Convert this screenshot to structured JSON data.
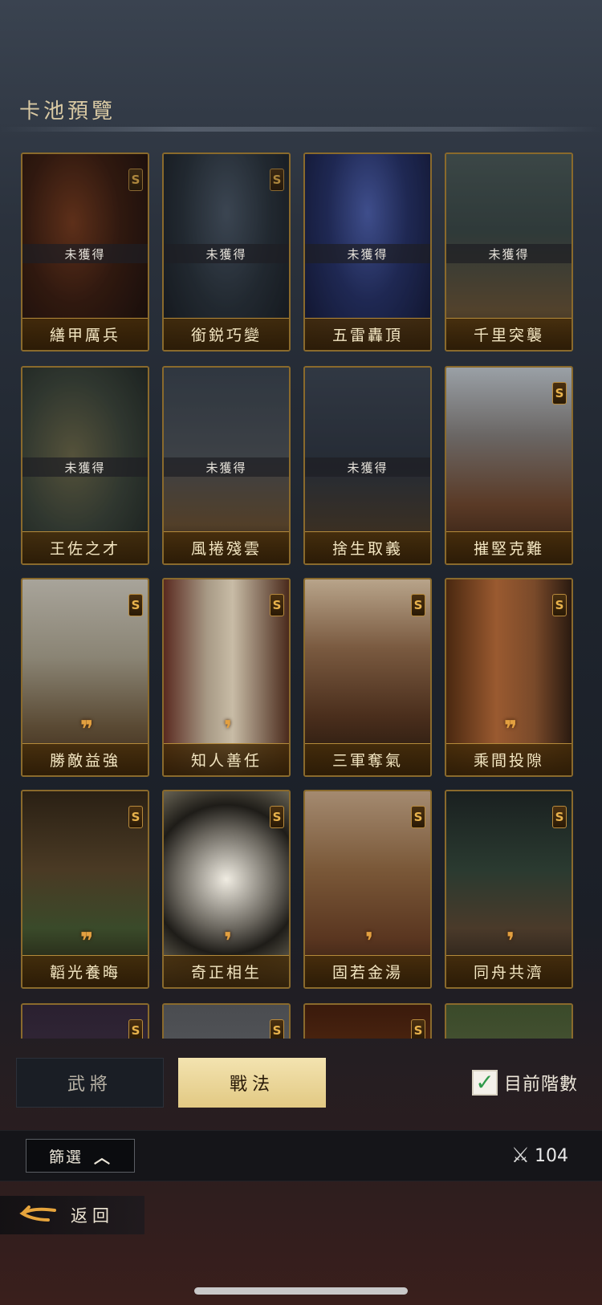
{
  "page_title": "卡池預覽",
  "unobtained_label": "未獲得",
  "cards": [
    {
      "name": "繕甲厲兵",
      "grade": "S",
      "obtained": false
    },
    {
      "name": "銜鋭巧變",
      "grade": "S",
      "obtained": false
    },
    {
      "name": "五雷轟頂",
      "grade": "",
      "obtained": false
    },
    {
      "name": "千里突襲",
      "grade": "",
      "obtained": false
    },
    {
      "name": "王佐之才",
      "grade": "",
      "obtained": false
    },
    {
      "name": "風捲殘雲",
      "grade": "",
      "obtained": false
    },
    {
      "name": "捨生取義",
      "grade": "",
      "obtained": false
    },
    {
      "name": "摧堅克難",
      "grade": "S",
      "obtained": true
    },
    {
      "name": "勝敵益強",
      "grade": "S",
      "obtained": true,
      "quotes": 2
    },
    {
      "name": "知人善任",
      "grade": "S",
      "obtained": true,
      "quotes": 1
    },
    {
      "name": "三軍奪氣",
      "grade": "S",
      "obtained": true
    },
    {
      "name": "乘間投隙",
      "grade": "S",
      "obtained": true,
      "quotes": 2
    },
    {
      "name": "韜光養晦",
      "grade": "S",
      "obtained": true,
      "quotes": 2
    },
    {
      "name": "奇正相生",
      "grade": "S",
      "obtained": true,
      "quotes": 1
    },
    {
      "name": "固若金湯",
      "grade": "S",
      "obtained": true,
      "quotes": 1
    },
    {
      "name": "同舟共濟",
      "grade": "S",
      "obtained": true,
      "quotes": 1
    },
    {
      "name": "",
      "grade": "S",
      "obtained": true
    },
    {
      "name": "",
      "grade": "S",
      "obtained": true
    },
    {
      "name": "",
      "grade": "S",
      "obtained": true
    },
    {
      "name": "",
      "grade": "",
      "obtained": true
    }
  ],
  "tabs": {
    "generals": "武將",
    "tactics": "戰法",
    "active": "tactics"
  },
  "current_tier": {
    "label": "目前階數",
    "checked": true
  },
  "filter": {
    "label": "篩選",
    "count": "104"
  },
  "back": {
    "label": "返回"
  },
  "colors": {
    "gold_border": "#8a6a2c",
    "active_tab": "#eed9a0",
    "check": "#2f9a4a"
  }
}
